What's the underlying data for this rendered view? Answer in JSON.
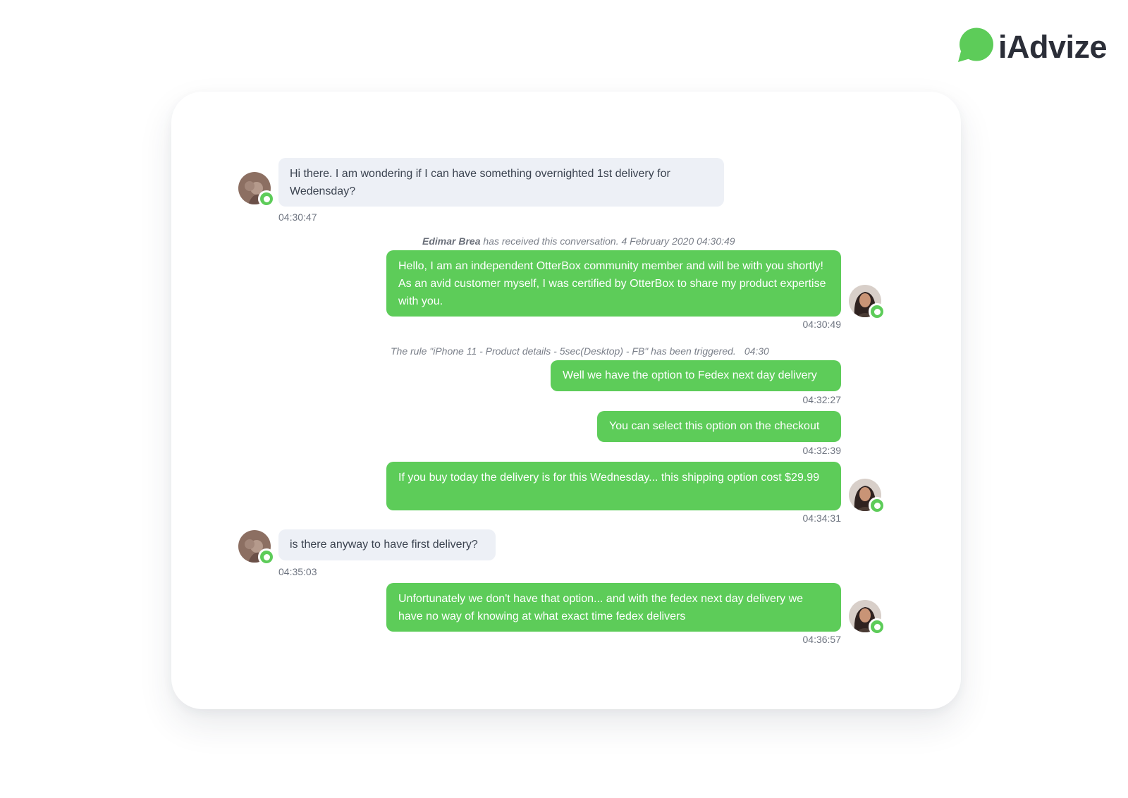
{
  "brand": {
    "logo_text": "iAdvize",
    "logo_icon": "speech-bubble-icon",
    "accent_color": "#5dcc59"
  },
  "conversation": {
    "messages": [
      {
        "sender": "visitor",
        "text": "Hi there. I am wondering if I can have something overnighted 1st delivery for Wedensday?",
        "time": "04:30:47"
      },
      {
        "sender": "system",
        "name": "Edimar Brea",
        "text": " has received this conversation. 4 February 2020 04:30:49"
      },
      {
        "sender": "agent",
        "text": "Hello, I am an independent OtterBox community member and will be with you shortly! As an avid customer myself, I was certified by OtterBox to share my product expertise with you.",
        "time": "04:30:49"
      },
      {
        "sender": "system",
        "text": "The rule \"iPhone 11 - Product details - 5sec(Desktop) - FB\" has been triggered.",
        "time": "04:30"
      },
      {
        "sender": "agent",
        "text": "Well we have the option to Fedex next day delivery",
        "time": "04:32:27"
      },
      {
        "sender": "agent",
        "text": "You can select this option on the checkout",
        "time": "04:32:39"
      },
      {
        "sender": "agent",
        "text": "If you buy today the delivery is for this Wednesday... this shipping option cost $29.99",
        "time": "04:34:31"
      },
      {
        "sender": "visitor",
        "text": "is there anyway to have first delivery?",
        "time": "04:35:03"
      },
      {
        "sender": "agent",
        "text": "Unfortunately we don't have that option... and with the fedex next day delivery we have no way of knowing at what exact time fedex delivers",
        "time": "04:36:57"
      }
    ]
  },
  "colors": {
    "agent_bubble": "#5dcc59",
    "visitor_bubble": "#edf0f6",
    "status_badge": "#5dcc59"
  }
}
